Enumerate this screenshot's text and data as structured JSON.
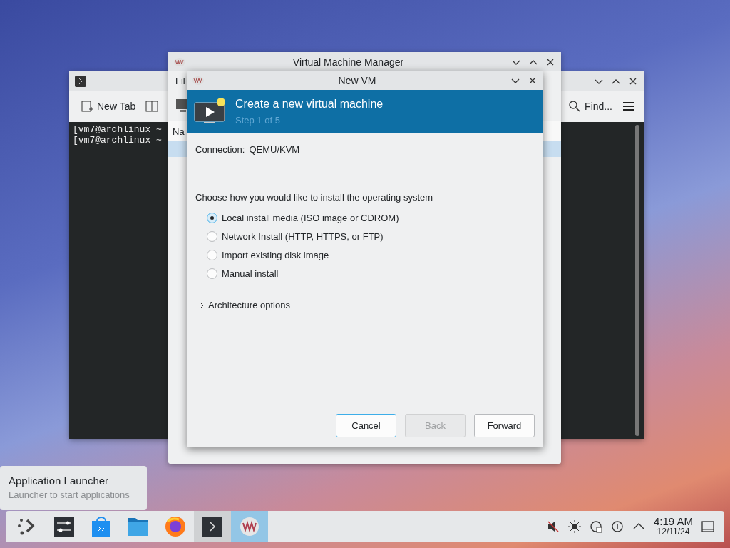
{
  "terminal": {
    "toolbar": {
      "new_tab": "New Tab",
      "find": "Find..."
    },
    "lines": [
      "[vm7@archlinux ~",
      "[vm7@archlinux ~"
    ]
  },
  "manager": {
    "title": "Virtual Machine Manager",
    "menu": [
      "Fil"
    ],
    "column_1": "Na"
  },
  "dialog": {
    "title": "New VM",
    "header": {
      "title": "Create a new virtual machine",
      "step": "Step 1 of 5"
    },
    "connection": {
      "label": "Connection:",
      "value": "QEMU/KVM"
    },
    "prompt": "Choose how you would like to install the operating system",
    "options": [
      {
        "label": "Local install media (ISO image or CDROM)",
        "selected": true
      },
      {
        "label": "Network Install (HTTP, HTTPS, or FTP)",
        "selected": false
      },
      {
        "label": "Import existing disk image",
        "selected": false
      },
      {
        "label": "Manual install",
        "selected": false
      }
    ],
    "expander": {
      "label": "Architecture options",
      "expanded": false
    },
    "buttons": [
      {
        "label": "Cancel",
        "focused": true,
        "disabled": false
      },
      {
        "label": "Back",
        "focused": false,
        "disabled": true
      },
      {
        "label": "Forward",
        "focused": false,
        "disabled": false
      }
    ]
  },
  "tooltip": {
    "title": "Application Launcher",
    "subtitle": "Launcher to start applications"
  },
  "taskbar": {
    "apps": [
      {
        "kind": "launcher",
        "open": false,
        "active": false
      },
      {
        "kind": "settings",
        "open": false,
        "active": false
      },
      {
        "kind": "store",
        "open": false,
        "active": false
      },
      {
        "kind": "files",
        "open": false,
        "active": false
      },
      {
        "kind": "browser",
        "open": false,
        "active": false
      },
      {
        "kind": "terminal",
        "open": true,
        "active": false
      },
      {
        "kind": "vm",
        "open": true,
        "active": true
      }
    ],
    "clock": {
      "time": "4:19 AM",
      "date": "12/11/24"
    }
  }
}
